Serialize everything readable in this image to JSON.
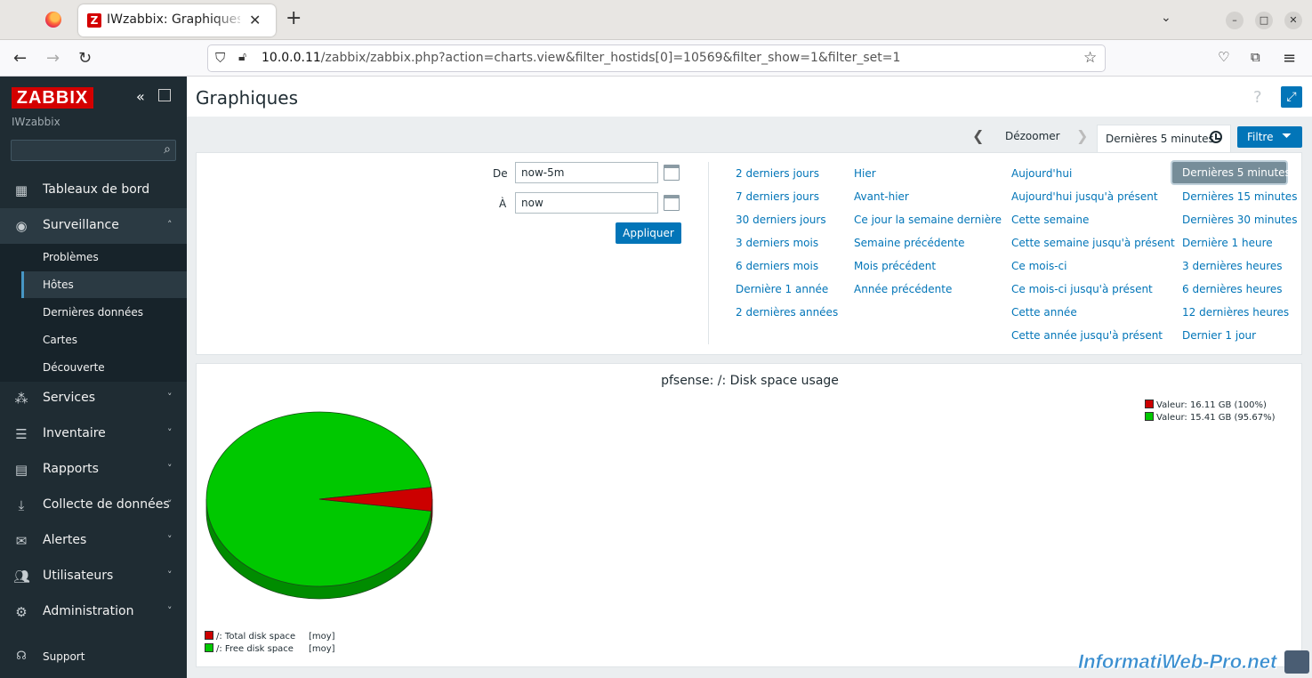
{
  "browser": {
    "tab_title": "IWzabbix: Graphiques per",
    "tab_close": "✕",
    "new_tab": "+",
    "url_host": "10.0.0.11",
    "url_path": "/zabbix/zabbix.php?action=charts.view&filter_hostids[0]=10569&filter_show=1&filter_set=1"
  },
  "sidebar": {
    "logo": "ZABBIX",
    "server_name": "IWzabbix",
    "search_placeholder": "",
    "menu": [
      {
        "label": "Tableaux de bord",
        "icon": "dashboard-icon"
      },
      {
        "label": "Surveillance",
        "icon": "eye-icon"
      },
      {
        "label": "Services",
        "icon": "services-icon"
      },
      {
        "label": "Inventaire",
        "icon": "list-icon"
      },
      {
        "label": "Rapports",
        "icon": "reports-icon"
      },
      {
        "label": "Collecte de données",
        "icon": "download-icon"
      },
      {
        "label": "Alertes",
        "icon": "alerts-icon"
      },
      {
        "label": "Utilisateurs",
        "icon": "users-icon"
      },
      {
        "label": "Administration",
        "icon": "gear-icon"
      }
    ],
    "submenu": [
      "Problèmes",
      "Hôtes",
      "Dernières données",
      "Cartes",
      "Découverte"
    ],
    "support": "Support"
  },
  "header": {
    "title": "Graphiques",
    "help": "?"
  },
  "timebar": {
    "zoom_out": "Dézoomer",
    "current_period": "Dernières 5 minutes",
    "filter_label": "Filtre"
  },
  "filter": {
    "from_label": "De",
    "from_value": "now-5m",
    "to_label": "À",
    "to_value": "now",
    "apply": "Appliquer",
    "quick_col1": [
      "2 derniers jours",
      "7 derniers jours",
      "30 derniers jours",
      "3 derniers mois",
      "6 derniers mois",
      "Dernière 1 année",
      "2 dernières années"
    ],
    "quick_col2": [
      "Hier",
      "Avant-hier",
      "Ce jour la semaine dernière",
      "Semaine précédente",
      "Mois précédent",
      "Année précédente"
    ],
    "quick_col3": [
      "Aujourd'hui",
      "Aujourd'hui jusqu'à présent",
      "Cette semaine",
      "Cette semaine jusqu'à présent",
      "Ce mois-ci",
      "Ce mois-ci jusqu'à présent",
      "Cette année",
      "Cette année jusqu'à présent"
    ],
    "quick_col4": [
      "Dernières 5 minutes",
      "Dernières 15 minutes",
      "Dernières 30 minutes",
      "Dernière 1 heure",
      "3 dernières heures",
      "6 dernières heures",
      "12 dernières heures",
      "Dernier 1 jour"
    ]
  },
  "chart_data": {
    "type": "pie",
    "title": "pfsense: /: Disk space usage",
    "series": [
      {
        "name": "/: Total disk space",
        "aggregation": "[moy]",
        "legend_value": "Valeur: 16.11 GB (100%)",
        "value_gb": 16.11,
        "color": "#cc0000"
      },
      {
        "name": "/: Free disk space",
        "aggregation": "[moy]",
        "legend_value": "Valeur: 15.41 GB (95.67%)",
        "value_gb": 15.41,
        "color": "#00c800"
      }
    ],
    "legend_placement": "top-right and bottom-left"
  },
  "watermark": "InformatiWeb-Pro.net"
}
